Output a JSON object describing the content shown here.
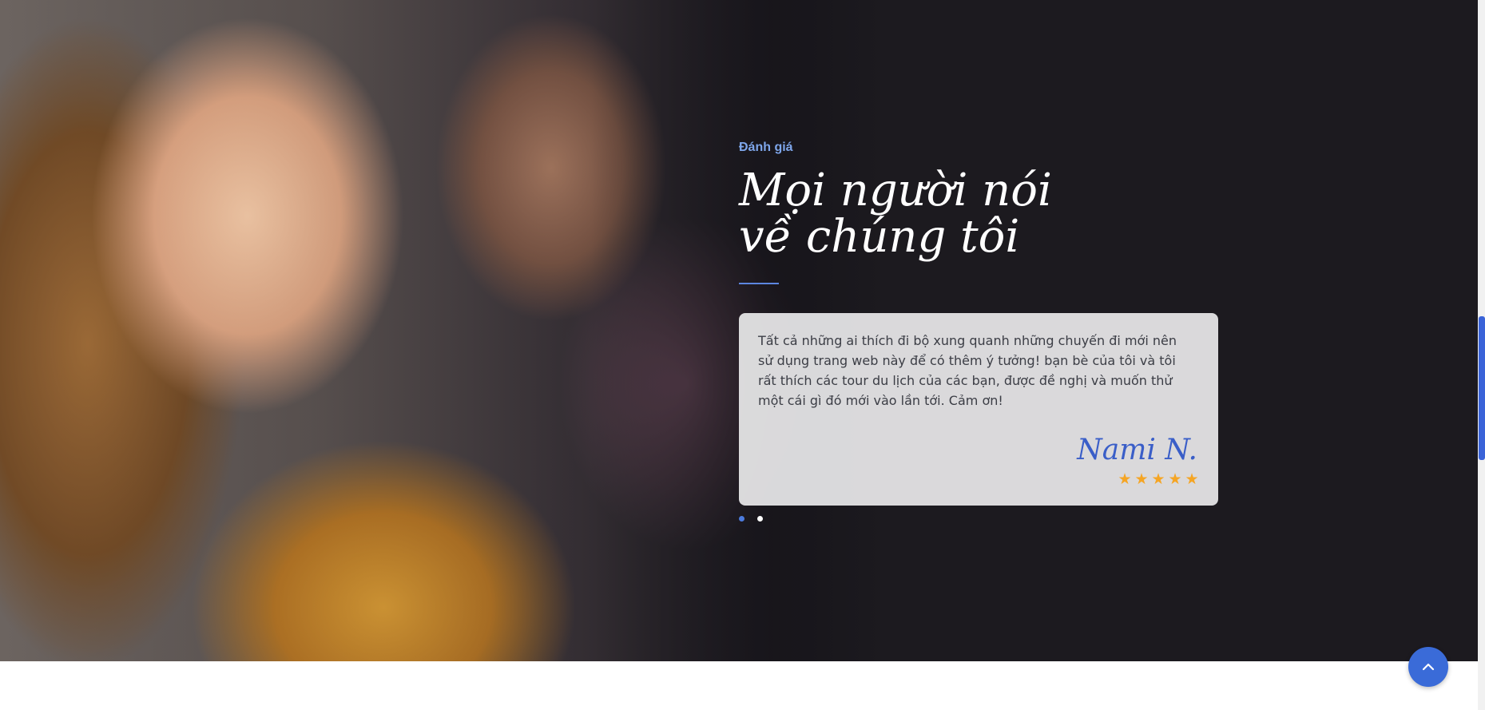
{
  "testimonials": {
    "eyebrow": "Đánh giá",
    "heading": "Mọi người nói về chúng tôi",
    "review": {
      "text": "Tất cả những ai thích đi bộ xung quanh những chuyến đi mới nên sử dụng trang web này để có thêm ý tưởng! bạn bè của tôi và tôi rất thích các tour du lịch của các bạn, được đề nghị và muốn thử một cái gì đó mới vào lần tới. Cảm ơn!",
      "author": "Nami N.",
      "rating": 5
    },
    "carousel": {
      "slide_count": 2,
      "active_index": 0
    }
  },
  "icons": {
    "star": "star-icon",
    "back_to_top": "chevron-up-icon"
  },
  "colors": {
    "accent": "#3a6bd8",
    "eyebrow": "#7ea6ea",
    "star": "#f5a524",
    "author": "#3a5ec8"
  }
}
